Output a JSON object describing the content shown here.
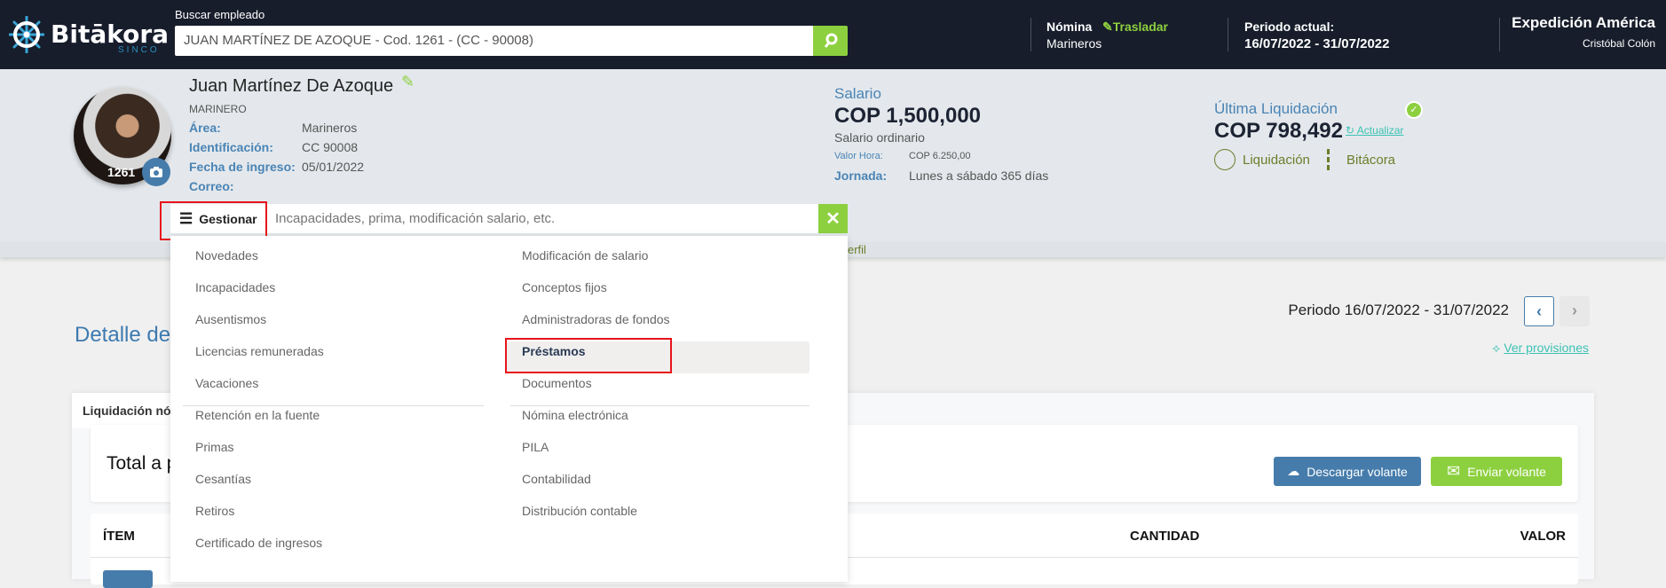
{
  "header": {
    "logo_text": "Bitākora",
    "logo_sub": "SINCO",
    "search_label": "Buscar empleado",
    "search_value": "JUAN MARTÍNEZ DE AZOQUE - Cod. 1261 - (CC - 90008)",
    "nomina_label": "Nómina",
    "trasladar": "Trasladar",
    "nomina_value": "Marineros",
    "periodo_label": "Periodo actual:",
    "periodo_value": "16/07/2022 - 31/07/2022",
    "company": "Expedición América",
    "user": "Cristóbal Colón"
  },
  "employee": {
    "name": "Juan Martínez De Azoque",
    "code": "1261",
    "role": "MARINERO",
    "fields": [
      {
        "label": "Área:",
        "value": "Marineros"
      },
      {
        "label": "Identificación:",
        "value": "CC 90008"
      },
      {
        "label": "Fecha de ingreso:",
        "value": "05/01/2022"
      },
      {
        "label": "Correo:",
        "value": ""
      }
    ]
  },
  "salary": {
    "label": "Salario",
    "amount": "COP 1,500,000",
    "type": "Salario ordinario",
    "hour_label": "Valor Hora:",
    "hour_value": "COP 6.250,00",
    "jornada_label": "Jornada:",
    "jornada_value": "Lunes a sábado 365 días"
  },
  "liquidacion": {
    "label": "Última Liquidación",
    "amount": "COP 798,492",
    "refresh": "Actualizar",
    "link1": "Liquidación",
    "link2": "Bitácora"
  },
  "gestionar": {
    "button": "Gestionar",
    "placeholder": "Incapacidades, prima, modificación salario, etc.",
    "left_items": [
      "Novedades",
      "Incapacidades",
      "Ausentismos",
      "Licencias remuneradas",
      "Vacaciones",
      "Retención en la fuente",
      "Primas",
      "Cesantías",
      "Retiros",
      "Certificado de ingresos"
    ],
    "right_items": [
      "Modificación de salario",
      "Conceptos fijos",
      "Administradoras de fondos",
      "Préstamos",
      "Documentos",
      "Nómina electrónica",
      "PILA",
      "Contabilidad",
      "Distribución contable"
    ],
    "highlighted": "Préstamos"
  },
  "tabs": {
    "perfil_partial": "erfil",
    "liquidacion_partial": "Liquidación nó"
  },
  "main": {
    "title_partial": "Detalle de",
    "period": "Periodo 16/07/2022 - 31/07/2022",
    "ver_provisiones": "Ver provisiones",
    "total_partial": "Total a p",
    "download": "Descargar volante",
    "send": "Enviar volante",
    "columns": [
      "ÍTEM",
      "CANTIDAD",
      "VALOR"
    ]
  },
  "colors": {
    "header_bg": "#171d2b",
    "accent_green": "#8dd03f",
    "label_blue": "#4a84b5",
    "button_blue": "#467cab",
    "highlight_red": "#e8141c"
  }
}
